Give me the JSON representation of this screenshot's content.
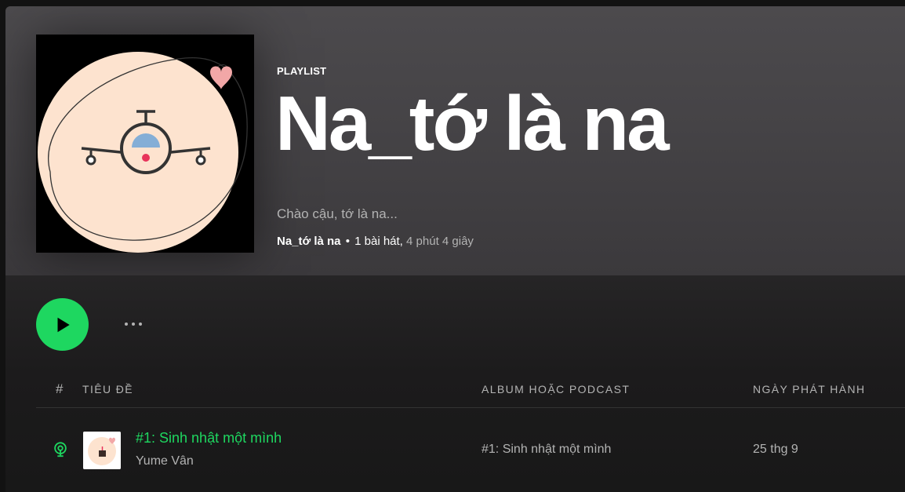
{
  "header": {
    "type_label": "PLAYLIST",
    "title": "Na_tớ là na",
    "description": "Chào cậu, tớ là na...",
    "owner": "Na_tớ là na",
    "separator": "•",
    "song_count": "1 bài hát,",
    "duration": "4 phút 4 giây"
  },
  "actions": {
    "play_icon": "play-icon",
    "more_icon": "more-options-icon"
  },
  "table": {
    "columns": {
      "index": "#",
      "title": "TIÊU ĐỀ",
      "album": "ALBUM HOẶC PODCAST",
      "date": "NGÀY PHÁT HÀNH"
    },
    "rows": [
      {
        "index_icon": "podcast-icon",
        "title": "#1: Sinh nhật một mình",
        "artist": "Yume Vân",
        "album": "#1: Sinh nhật một mình",
        "date": "25 thg 9"
      }
    ]
  },
  "colors": {
    "accent": "#1ed760",
    "header_bg": "#4c4a4d",
    "content_bg": "#181818",
    "cover_circle": "#fde3cf"
  }
}
